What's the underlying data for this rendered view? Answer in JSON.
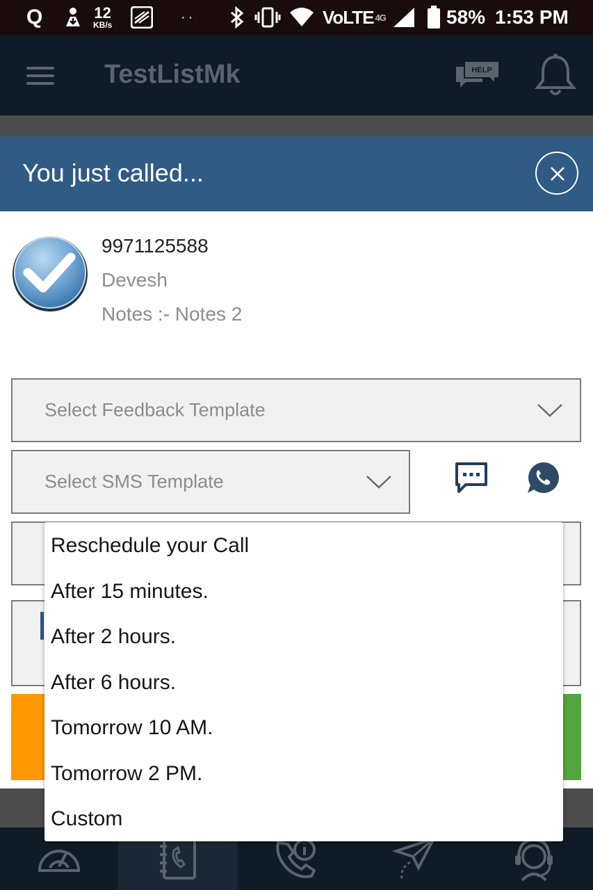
{
  "status_bar": {
    "q_label": "Q",
    "speed_value": "12",
    "speed_unit": "KB/s",
    "dots": "··",
    "network": "VoLTE",
    "network_sup": "4G",
    "battery_percent": "58%",
    "time": "1:53 PM"
  },
  "app_header": {
    "title": "TestListMk",
    "help_label": "HELP"
  },
  "dialog": {
    "title": "You just called...",
    "contact": {
      "number": "9971125588",
      "name": "Devesh",
      "notes": "Notes :- Notes 2"
    },
    "feedback_placeholder": "Select Feedback Template",
    "sms_placeholder": "Select SMS Template"
  },
  "dropdown": {
    "items": [
      "Reschedule your Call",
      "After 15 minutes.",
      "After 2 hours.",
      "After 6 hours.",
      "Tomorrow 10 AM.",
      "Tomorrow 2 PM.",
      "Custom"
    ]
  },
  "colors": {
    "dialog_header": "#2f5b84",
    "orange_button": "#ff9800",
    "green_button": "#53a63f",
    "whatsapp_icon": "#2f4a66"
  },
  "icons": {
    "nav": [
      "speedometer-icon",
      "phonebook-icon",
      "call-info-icon",
      "paper-plane-icon",
      "headset-support-icon"
    ]
  }
}
